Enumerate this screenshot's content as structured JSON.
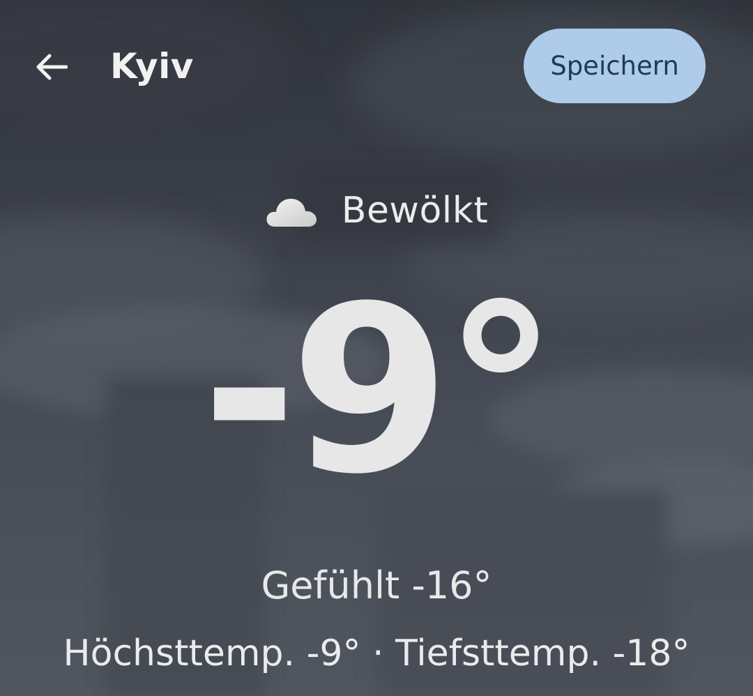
{
  "header": {
    "back_icon": "arrow-left-icon",
    "city": "Kyiv",
    "save_label": "Speichern"
  },
  "current": {
    "condition_icon": "cloud-icon",
    "condition": "Bewölkt",
    "temperature": "-9°",
    "feels_like": "Gefühlt -16°",
    "high_low": "Höchsttemp. -9° · Tiefsttemp. -18°"
  },
  "colors": {
    "background": "#383c45",
    "save_button": "#aecbea",
    "save_text": "#1e3a5a",
    "text": "#e6e6e6"
  }
}
